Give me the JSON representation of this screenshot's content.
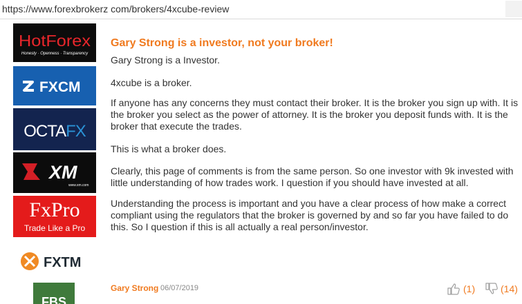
{
  "browser": {
    "url": "https://www.forexbrokerz com/brokers/4xcube-review"
  },
  "sidebar": {
    "brokers": [
      {
        "name": "HotForex",
        "tagline": "Honesty · Openness · Transparency"
      },
      {
        "name": "FXCM"
      },
      {
        "name": "OCTAFX"
      },
      {
        "name": "XM",
        "sub": "www.xm.com"
      },
      {
        "name": "FxPro",
        "tagline": "Trade Like a Pro"
      },
      {
        "name": "FXTM"
      },
      {
        "name": "FBS"
      }
    ]
  },
  "comment": {
    "title": "Gary Strong is a investor, not your broker!",
    "paragraphs": [
      "Gary Strong is a Investor.",
      "4xcube is a broker.",
      "If anyone has any concerns they must contact their broker. It is the broker you sign up with. It is the broker you select as the power of attorney. It is the broker you deposit funds with. It is the broker that execute the trades.",
      "This is what a broker does.",
      "Clearly, this page of comments is from the same person. So one investor with 9k invested with little understanding of how trades work. I question if you should have invested at all.",
      "Understanding the process is important and you have a clear process of how make a correct compliant using the regulators that the broker is governed by and so far you have failed to do this. So I question if this is all actually a real person/investor."
    ]
  },
  "next_comment": {
    "author": "Gary Strong",
    "date": "06/07/2019",
    "likes": "(1)",
    "dislikes": "(14)"
  },
  "colors": {
    "accent": "#f07a1f",
    "text": "#333333"
  }
}
